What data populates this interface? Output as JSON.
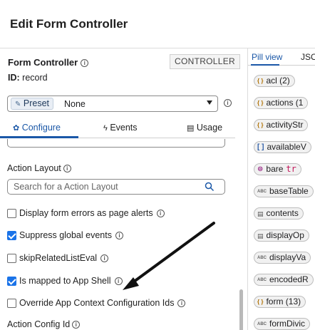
{
  "header": {
    "title": "Edit Form Controller"
  },
  "controller": {
    "title": "Form Controller",
    "badge": "CONTROLLER",
    "id_label": "ID:",
    "id_value": "record"
  },
  "preset": {
    "chip": "Preset",
    "value": "None"
  },
  "tabs": [
    {
      "label": "Configure",
      "icon": "gear-icon",
      "active": true
    },
    {
      "label": "Events",
      "icon": "lightning-icon",
      "active": false
    },
    {
      "label": "Usage",
      "icon": "list-icon",
      "active": false
    }
  ],
  "fields": {
    "action_layout_label": "Action Layout",
    "action_layout_placeholder": "Search for a Action Layout",
    "action_config_label": "Action Config Id"
  },
  "checkboxes": [
    {
      "label": "Display form errors as page alerts",
      "checked": false
    },
    {
      "label": "Suppress global events",
      "checked": true
    },
    {
      "label": "skipRelatedListEval",
      "checked": false
    },
    {
      "label": "Is mapped to App Shell",
      "checked": true
    },
    {
      "label": "Override App Context Configuration Ids",
      "checked": false
    }
  ],
  "right_panel": {
    "tabs": [
      "Pill view",
      "JSO"
    ],
    "pills": [
      {
        "icon": "object-icon",
        "text": "acl (2)"
      },
      {
        "icon": "object-icon",
        "text": "actions (1"
      },
      {
        "icon": "object-icon",
        "text": "activityStr"
      },
      {
        "icon": "array-icon",
        "text": "availableV"
      },
      {
        "icon": "boolean-icon",
        "text": "bare",
        "value": "tr"
      },
      {
        "icon": "string-icon",
        "text": "baseTable"
      },
      {
        "icon": "database-icon",
        "text": "contents"
      },
      {
        "icon": "database-icon",
        "text": "displayOp"
      },
      {
        "icon": "string-icon",
        "text": "displayVa"
      },
      {
        "icon": "string-icon",
        "text": "encodedR"
      },
      {
        "icon": "object-icon",
        "text": "form (13)"
      },
      {
        "icon": "string-icon",
        "text": "formDivic"
      }
    ]
  },
  "colors": {
    "accent": "#1a57a7",
    "checkbox": "#1a73e8"
  }
}
